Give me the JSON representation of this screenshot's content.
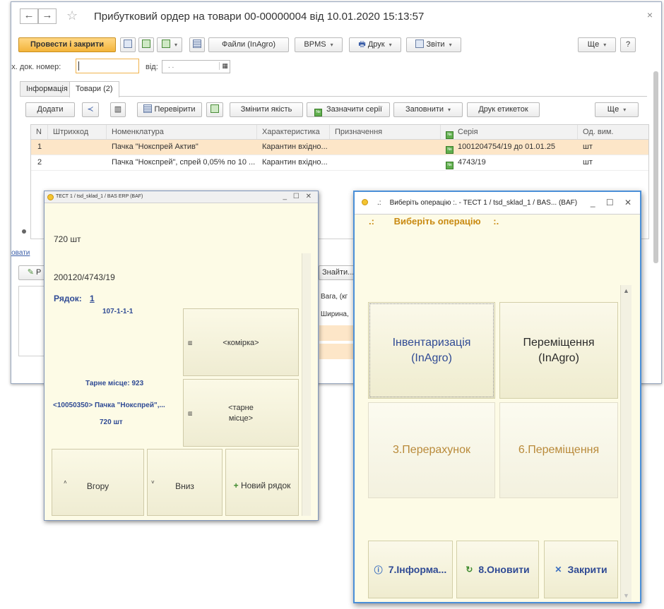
{
  "main": {
    "title": "Прибутковий ордер на товари 00-00000004 від 10.01.2020 15:13:57",
    "nav_back": "←",
    "nav_forward": "→",
    "favorite": "☆",
    "close": "×",
    "toolbar": {
      "post_close": "Провести і закрити",
      "files": "Файли (InAgro)",
      "bpms": "BPMS",
      "print": "Друк",
      "reports": "Звіти",
      "more": "Ще",
      "help": "?"
    },
    "fields": {
      "incoming_doc_label": "Вх. док. номер:",
      "incoming_doc_value": "",
      "date_label": "від:",
      "date_value": ". ."
    },
    "tabs": [
      "Інформація",
      "Товари (2)"
    ],
    "goods_toolbar": {
      "add": "Додати",
      "check": "Перевірити",
      "change_quality": "Змінити якість",
      "mark_series": "Зазначити серії",
      "fill": "Заповнити",
      "print_labels": "Друк етикеток",
      "more": "Ще"
    },
    "columns": [
      "N",
      "Штрихкод",
      "Номенклатура",
      "Характеристика",
      "Призначення",
      "Серія",
      "Од. вим."
    ],
    "rows": [
      {
        "n": "1",
        "barcode": "",
        "item": "Пачка \"Нокспрей Актив\"",
        "char": "Карантин вхідно...",
        "purpose": "",
        "series": "1001204754/19 до 01.01.25",
        "unit": "шт"
      },
      {
        "n": "2",
        "barcode": "",
        "item": "Пачка \"Нокспрей\", спрей 0,05% по 10 ...",
        "char": "Карантин вхідно...",
        "purpose": "",
        "series": "4743/19",
        "unit": "шт"
      }
    ],
    "hide_link": "Сховати",
    "find_btn": "Знайти...",
    "weight_label": "Вага, (кг",
    "width_label": "Ширина,",
    "pencil_label": "Р"
  },
  "tsd1": {
    "title": "ТЕСТ 1 / tsd_sklad_1 / BAS ERP (BAF)",
    "qty_top": "720 шт",
    "code": "200120/4743/19",
    "row_label": "Рядок:",
    "row_value": "1",
    "cell_code": "107-1-1-1",
    "cell_btn": "<комірка>",
    "pallet_info": "Тарне місце: 923",
    "product": "<10050350> Пачка \"Нокспрей\",...",
    "qty_bottom": "720 шт",
    "pallet_btn_line1": "<тарне",
    "pallet_btn_line2": "місце>",
    "up_btn": "Вгору",
    "down_btn": "Вниз",
    "new_row_btn": "Новий рядок",
    "winctl": "_ ☐ ✕"
  },
  "tsd2": {
    "title": "Виберіть операцію     :. - ТЕСТ 1 / tsd_sklad_1 / BAS... (BAF)",
    "title_prefix": ".:",
    "heading": "Виберіть операцію",
    "heading_prefix": ".:",
    "heading_suffix": ":.",
    "op1_line1": "Інвентаризація",
    "op1_line2": "(InAgro)",
    "op2_line1": "Переміщення",
    "op2_line2": "(InAgro)",
    "op3": "3.Перерахунок",
    "op4": "6.Переміщення",
    "info_btn": "7.Інформа...",
    "refresh_btn": "8.Оновити",
    "close_btn": "Закрити",
    "winctl": "_ ☐ ✕"
  },
  "colors": {
    "primary_button": "#f3b43a",
    "selected_row": "#fde6c8",
    "tsd_background": "#fdfbe6",
    "tsd_blue_text": "#2f4a94",
    "tsd_orange_text": "#c98a12",
    "active_window_border": "#4a8fd8"
  },
  "icons": [
    "back-arrow-icon",
    "forward-arrow-icon",
    "star-icon",
    "close-icon",
    "save-icon",
    "post-icon",
    "structure-icon",
    "document-icon",
    "printer-icon",
    "report-icon",
    "share-icon",
    "barcode-icon",
    "check-icon",
    "table-icon",
    "series-icon",
    "pencil-icon",
    "app-icon",
    "info-icon",
    "refresh-icon",
    "x-icon",
    "plus-icon"
  ]
}
